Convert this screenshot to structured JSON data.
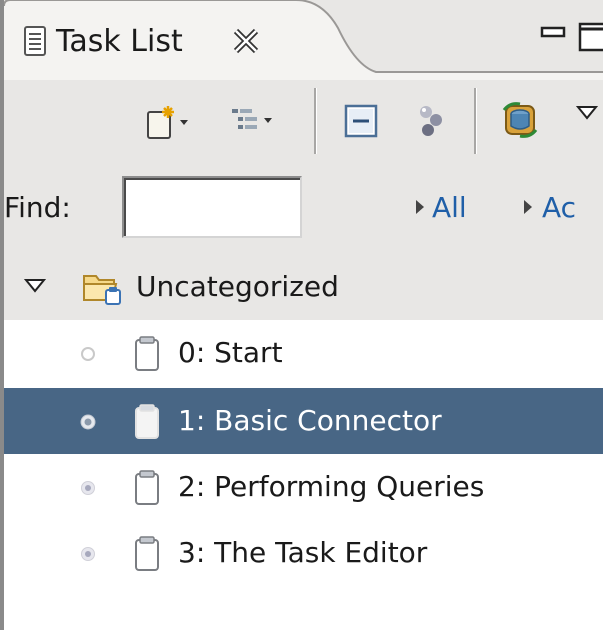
{
  "view": {
    "title": "Task List",
    "tab_icon": "task-list-icon",
    "close_icon": "close-icon",
    "minimize_icon": "minimize-icon",
    "maximize_icon": "maximize-icon"
  },
  "toolbar": {
    "buttons": [
      {
        "name": "new-task-icon",
        "has_dropdown": true
      },
      {
        "name": "presentation-icon",
        "has_dropdown": true
      },
      {
        "name": "collapse-all-icon",
        "has_dropdown": false
      },
      {
        "name": "focus-on-workweek-icon",
        "has_dropdown": false
      },
      {
        "name": "synchronize-icon",
        "has_dropdown": false
      },
      {
        "name": "view-menu-icon",
        "has_dropdown": false
      }
    ]
  },
  "find": {
    "label": "Find:",
    "value": "",
    "filters": [
      "All",
      "Ac"
    ]
  },
  "tree": {
    "category": {
      "label": "Uncategorized",
      "expanded": true,
      "icon": "folder-icon"
    },
    "tasks": [
      {
        "label": "0: Start",
        "status": "incomplete",
        "selected": false
      },
      {
        "label": "1: Basic Connector",
        "status": "active",
        "selected": true
      },
      {
        "label": "2: Performing Queries",
        "status": "scheduled",
        "selected": false
      },
      {
        "label": "3: The Task Editor",
        "status": "scheduled",
        "selected": false
      }
    ]
  },
  "colors": {
    "chrome": "#e8e7e5",
    "selection": "#486685",
    "link": "#1f5fa8"
  }
}
